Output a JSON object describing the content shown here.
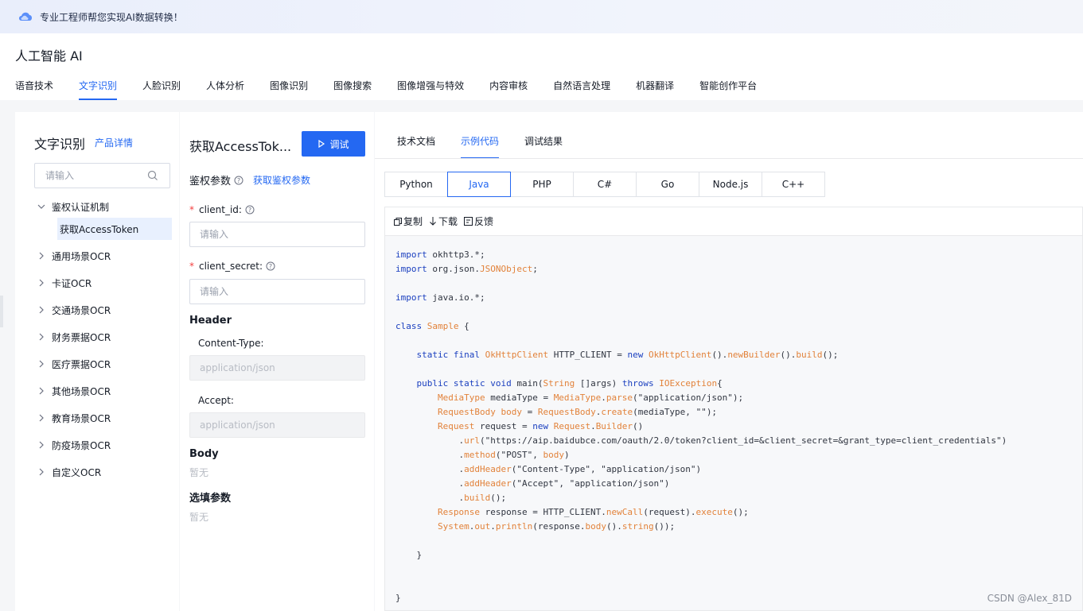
{
  "banner": {
    "text": "专业工程师帮您实现AI数据转换！"
  },
  "app": {
    "title": "人工智能 AI"
  },
  "topnav": {
    "items": [
      "语音技术",
      "文字识别",
      "人脸识别",
      "人体分析",
      "图像识别",
      "图像搜索",
      "图像增强与特效",
      "内容审核",
      "自然语言处理",
      "机器翻译",
      "智能创作平台"
    ],
    "active": "文字识别"
  },
  "sidebar": {
    "title": "文字识别",
    "product_link": "产品详情",
    "search_placeholder": "请输入",
    "tree": [
      {
        "label": "鉴权认证机制",
        "expanded": true,
        "children": [
          "获取AccessToken"
        ]
      },
      {
        "label": "通用场景OCR"
      },
      {
        "label": "卡证OCR"
      },
      {
        "label": "交通场景OCR"
      },
      {
        "label": "财务票据OCR"
      },
      {
        "label": "医疗票据OCR"
      },
      {
        "label": "其他场景OCR"
      },
      {
        "label": "教育场景OCR"
      },
      {
        "label": "防疫场景OCR"
      },
      {
        "label": "自定义OCR"
      }
    ]
  },
  "form": {
    "api_title": "获取AccessTok...",
    "debug_button": "调试",
    "auth_params": "鉴权参数",
    "get_auth_link": "获取鉴权参数",
    "client_id_label": "client_id:",
    "client_id_placeholder": "请输入",
    "client_secret_label": "client_secret:",
    "client_secret_placeholder": "请输入",
    "header_title": "Header",
    "content_type_label": "Content-Type:",
    "content_type_value": "application/json",
    "accept_label": "Accept:",
    "accept_value": "application/json",
    "body_title": "Body",
    "body_empty": "暂无",
    "optional_title": "选填参数",
    "optional_empty": "暂无"
  },
  "code_panel": {
    "tabs": [
      "技术文档",
      "示例代码",
      "调试结果"
    ],
    "active_tab": "示例代码",
    "languages": [
      "Python",
      "Java",
      "PHP",
      "C#",
      "Go",
      "Node.js",
      "C++"
    ],
    "active_language": "Java",
    "toolbar": {
      "copy": "复制",
      "download": "下载",
      "feedback": "反馈"
    },
    "code_lines": [
      "import okhttp3.*;",
      "import org.json.JSONObject;",
      "",
      "import java.io.*;",
      "",
      "class Sample {",
      "",
      "    static final OkHttpClient HTTP_CLIENT = new OkHttpClient().newBuilder().build();",
      "",
      "    public static void main(String []args) throws IOException{",
      "        MediaType mediaType = MediaType.parse(\"application/json\");",
      "        RequestBody body = RequestBody.create(mediaType, \"\");",
      "        Request request = new Request.Builder()",
      "            .url(\"https://aip.baidubce.com/oauth/2.0/token?client_id=&client_secret=&grant_type=client_credentials\")",
      "            .method(\"POST\", body)",
      "            .addHeader(\"Content-Type\", \"application/json\")",
      "            .addHeader(\"Accept\", \"application/json\")",
      "            .build();",
      "        Response response = HTTP_CLIENT.newCall(request).execute();",
      "        System.out.println(response.body().string());",
      "",
      "    }",
      "",
      "",
      "}"
    ]
  },
  "watermark": "CSDN @Alex_81D",
  "colors": {
    "accent": "#2468f2",
    "required": "#f33e3e",
    "keyword": "#1a3fbf",
    "type": "#e2823a"
  }
}
